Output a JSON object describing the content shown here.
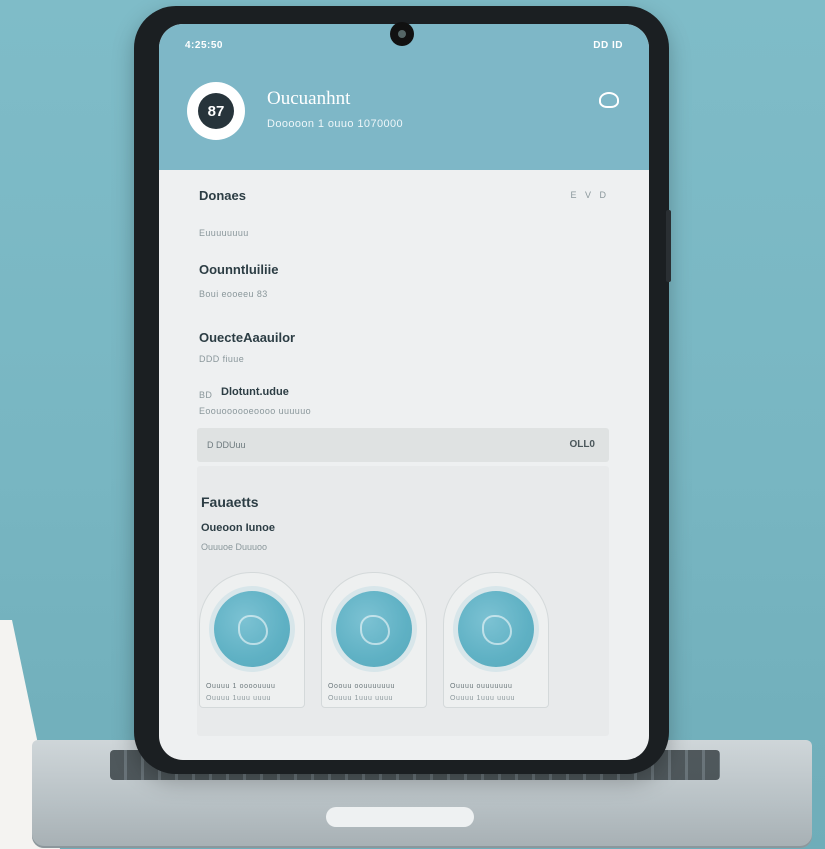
{
  "status_bar": {
    "time": "4:25:50",
    "indicators": "DD ID"
  },
  "header": {
    "avatar_text": "87",
    "title": "Oucuanhnt",
    "subtitle": "Dooooon 1 ouuo 1070000",
    "settings_icon": "eye-icon"
  },
  "details": {
    "heading": "Donaes",
    "edit_label": "E V D",
    "heading_caption": "Euuuuuuuu",
    "field1_label": "Oounntluiliie",
    "field1_value": "Boui eooeeu 83",
    "field2_label": "OuecteAaauilor",
    "field2_value": "DDD fiuue",
    "field3_prefix": "BD",
    "field3_label": "Dlotunt.udue",
    "field3_value": "Eoouoooooeoooo uuuuuo"
  },
  "row": {
    "left": "D DDUuu",
    "right": "OLL0"
  },
  "favorites": {
    "title": "Fauaetts",
    "subtitle": "Oueoon Iunoe",
    "caption": "Ouuuoe Duuuoo",
    "cards": [
      {
        "line1": "Ouuuu 1 oooouuuu",
        "line2": "Ouuuu 1uuu uuuu"
      },
      {
        "line1": "Ooouu oouuuuuuu",
        "line2": "Ouuuu 1uuu uuuu"
      },
      {
        "line1": "Ouuuu ouuuuuuu",
        "line2": "Ouuuu 1uuu uuuu"
      }
    ]
  },
  "colors": {
    "header_bg": "#7eb7c7",
    "accent_circle": "#5fb1c4",
    "background": "#7fbcc8"
  }
}
